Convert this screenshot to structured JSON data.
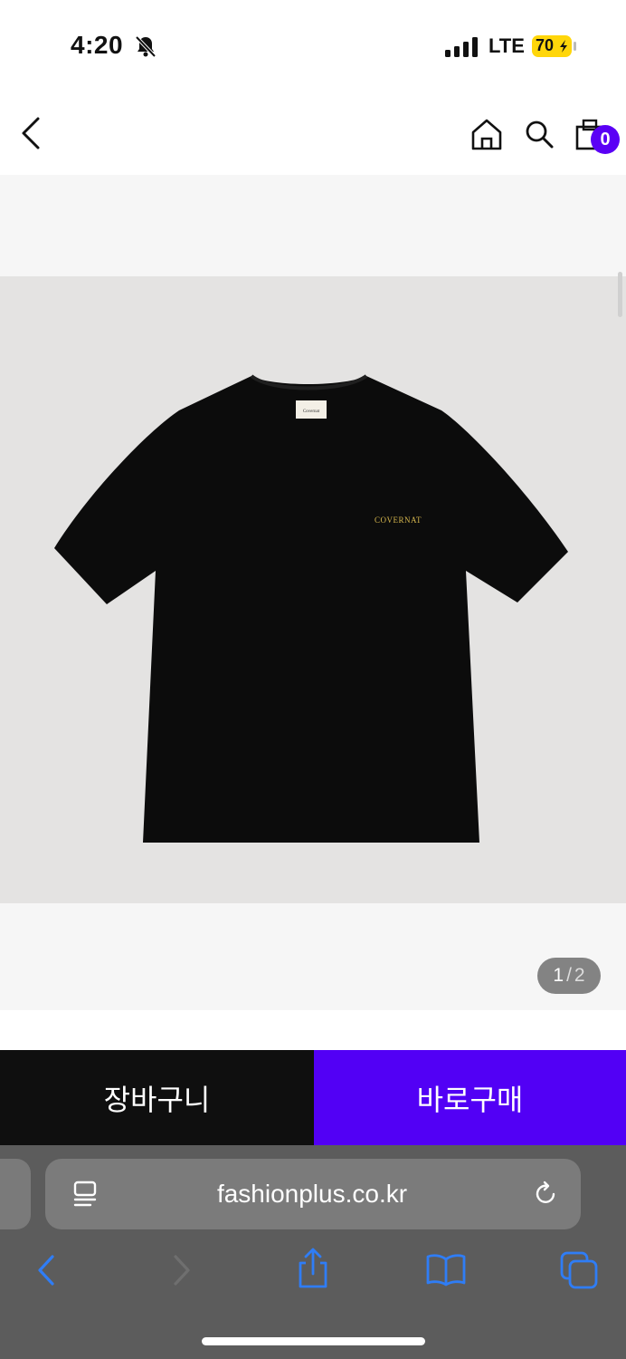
{
  "status_bar": {
    "time": "4:20",
    "network": "LTE",
    "battery": "70"
  },
  "header": {
    "cart_count": "0"
  },
  "product": {
    "shirt_logo_text": "COVERNAT",
    "pager": {
      "current": "1",
      "separator": "/",
      "total": "2"
    }
  },
  "actions": {
    "cart_label": "장바구니",
    "buy_label": "바로구매"
  },
  "browser": {
    "url": "fashionplus.co.kr"
  },
  "colors": {
    "accent": "#5200f5",
    "dark_button": "#0f0f0f",
    "gallery_bg": "#e4e3e2",
    "safari_bg": "#5c5c5c",
    "safari_icon": "#2f7df6"
  },
  "icons": [
    "bell-slash-icon",
    "signal-icon",
    "battery-icon",
    "back-chevron-icon",
    "home-icon",
    "search-icon",
    "shopping-bag-icon",
    "reader-icon",
    "reload-icon",
    "share-icon",
    "bookmarks-icon",
    "tabs-icon"
  ]
}
